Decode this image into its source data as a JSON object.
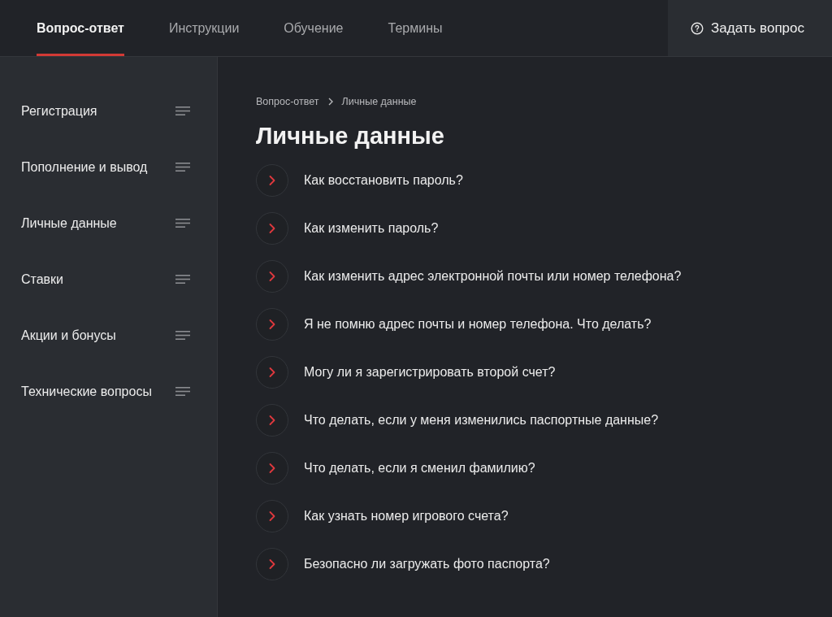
{
  "nav": {
    "tabs": [
      {
        "label": "Вопрос-ответ",
        "selected": true
      },
      {
        "label": "Инструкции",
        "selected": false
      },
      {
        "label": "Обучение",
        "selected": false
      },
      {
        "label": "Термины",
        "selected": false
      }
    ],
    "ask_button": "Задать вопрос"
  },
  "sidebar": {
    "items": [
      "Регистрация",
      "Пополнение и вывод",
      "Личные данные",
      "Ставки",
      "Акции и бонусы",
      "Технические вопросы"
    ]
  },
  "breadcrumb": [
    "Вопрос-ответ",
    "Личные данные"
  ],
  "title": "Личные данные",
  "questions": [
    "Как восстановить пароль?",
    "Как изменить пароль?",
    "Как изменить адрес электронной почты или номер телефона?",
    "Я не помню адрес почты и номер телефона. Что делать?",
    "Могу ли я зарегистрировать второй счет?",
    "Что делать, если у меня изменились паспортные данные?",
    "Что делать, если я сменил фамилию?",
    "Как узнать номер игрового счета?",
    "Безопасно ли загружать фото паспорта?"
  ]
}
